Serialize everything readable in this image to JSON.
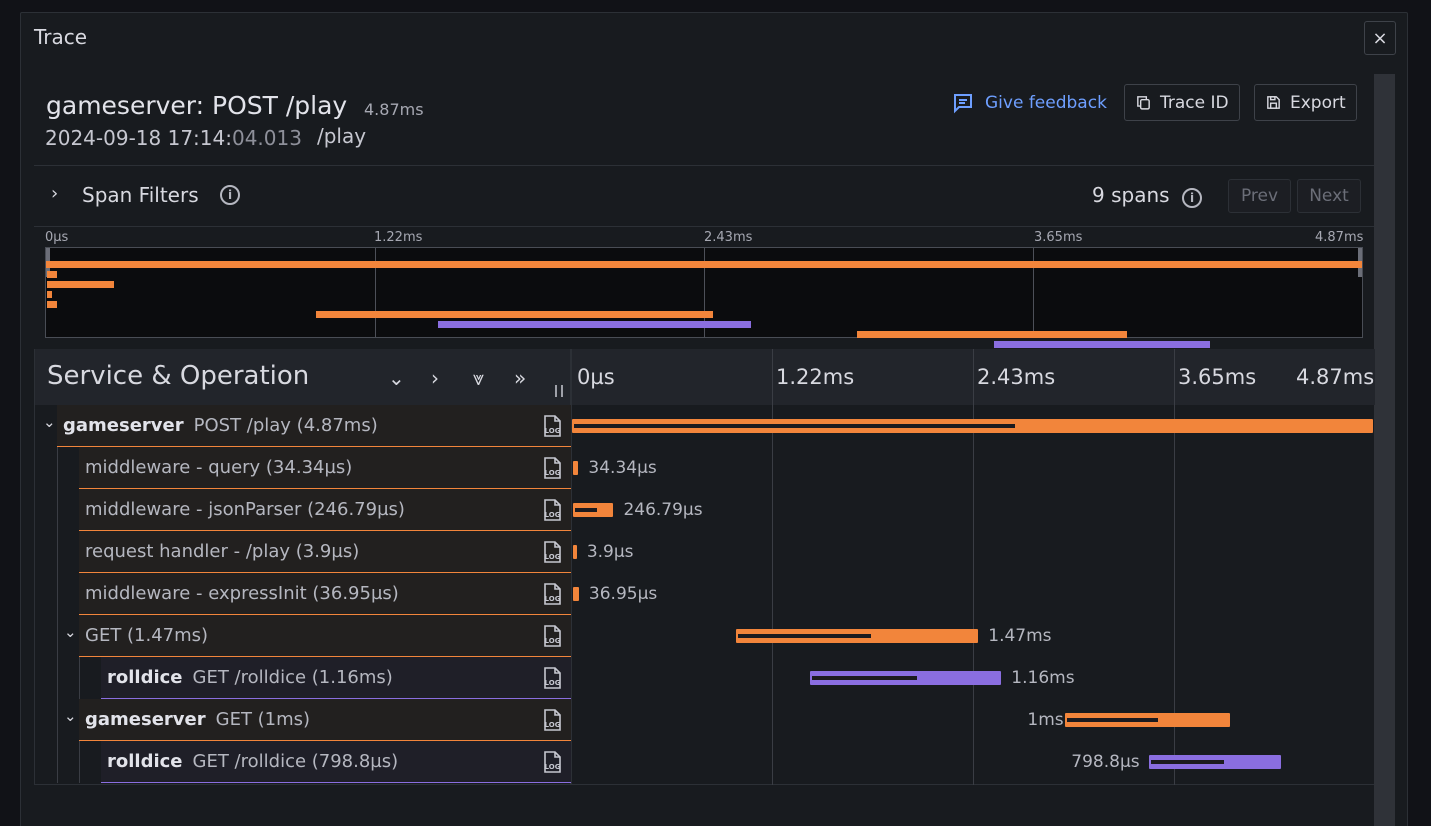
{
  "drawer": {
    "title": "Trace",
    "close": "×"
  },
  "trace": {
    "title": "gameserver: POST /play",
    "duration": "4.87ms",
    "date_main": "2024-09-18 17:14:",
    "date_ms": "04.013",
    "url": "/play"
  },
  "actions": {
    "feedback": "Give feedback",
    "trace_id": "Trace ID",
    "export": "Export"
  },
  "filters": {
    "label": "Span Filters",
    "span_count": "9 spans",
    "prev": "Prev",
    "next": "Next"
  },
  "minimap": {
    "ticks": [
      "0µs",
      "1.22ms",
      "2.43ms",
      "3.65ms",
      "4.87ms"
    ]
  },
  "timeline": {
    "header": "Service & Operation",
    "ticks": [
      "0µs",
      "1.22ms",
      "2.43ms",
      "3.65ms",
      "4.87ms"
    ],
    "log_label": "LOG"
  },
  "colors": {
    "gameserver": "#f2853b",
    "rolldice": "#8a6ee0"
  },
  "spans": [
    {
      "service": "gameserver",
      "operation": "POST /play (4.87ms)",
      "duration_label": "",
      "start_ms": 0,
      "duration_ms": 4.87,
      "depth": 0,
      "collapsible": true,
      "color": "gameserver"
    },
    {
      "service": "",
      "operation": "middleware - query (34.34µs)",
      "duration_label": "34.34µs",
      "start_ms": 0.005,
      "duration_ms": 0.034,
      "depth": 1,
      "collapsible": false,
      "color": "gameserver"
    },
    {
      "service": "",
      "operation": "middleware - jsonParser (246.79µs)",
      "duration_label": "246.79µs",
      "start_ms": 0.005,
      "duration_ms": 0.247,
      "depth": 1,
      "collapsible": false,
      "color": "gameserver"
    },
    {
      "service": "",
      "operation": "request handler - /play (3.9µs)",
      "duration_label": "3.9µs",
      "start_ms": 0.005,
      "duration_ms": 0.004,
      "depth": 1,
      "collapsible": false,
      "color": "gameserver"
    },
    {
      "service": "",
      "operation": "middleware - expressInit (36.95µs)",
      "duration_label": "36.95µs",
      "start_ms": 0.005,
      "duration_ms": 0.037,
      "depth": 1,
      "collapsible": false,
      "color": "gameserver"
    },
    {
      "service": "",
      "operation": "GET (1.47ms)",
      "duration_label": "1.47ms",
      "start_ms": 1.0,
      "duration_ms": 1.47,
      "depth": 1,
      "collapsible": true,
      "color": "gameserver"
    },
    {
      "service": "rolldice",
      "operation": "GET /rolldice (1.16ms)",
      "duration_label": "1.16ms",
      "start_ms": 1.45,
      "duration_ms": 1.16,
      "depth": 2,
      "collapsible": false,
      "color": "rolldice"
    },
    {
      "service": "gameserver",
      "operation": "GET (1ms)",
      "duration_label": "1ms",
      "start_ms": 3.0,
      "duration_ms": 1.0,
      "depth": 1,
      "collapsible": true,
      "color": "gameserver"
    },
    {
      "service": "rolldice",
      "operation": "GET /rolldice (798.8µs)",
      "duration_label": "798.8µs",
      "start_ms": 3.51,
      "duration_ms": 0.799,
      "depth": 2,
      "collapsible": false,
      "color": "rolldice"
    }
  ]
}
